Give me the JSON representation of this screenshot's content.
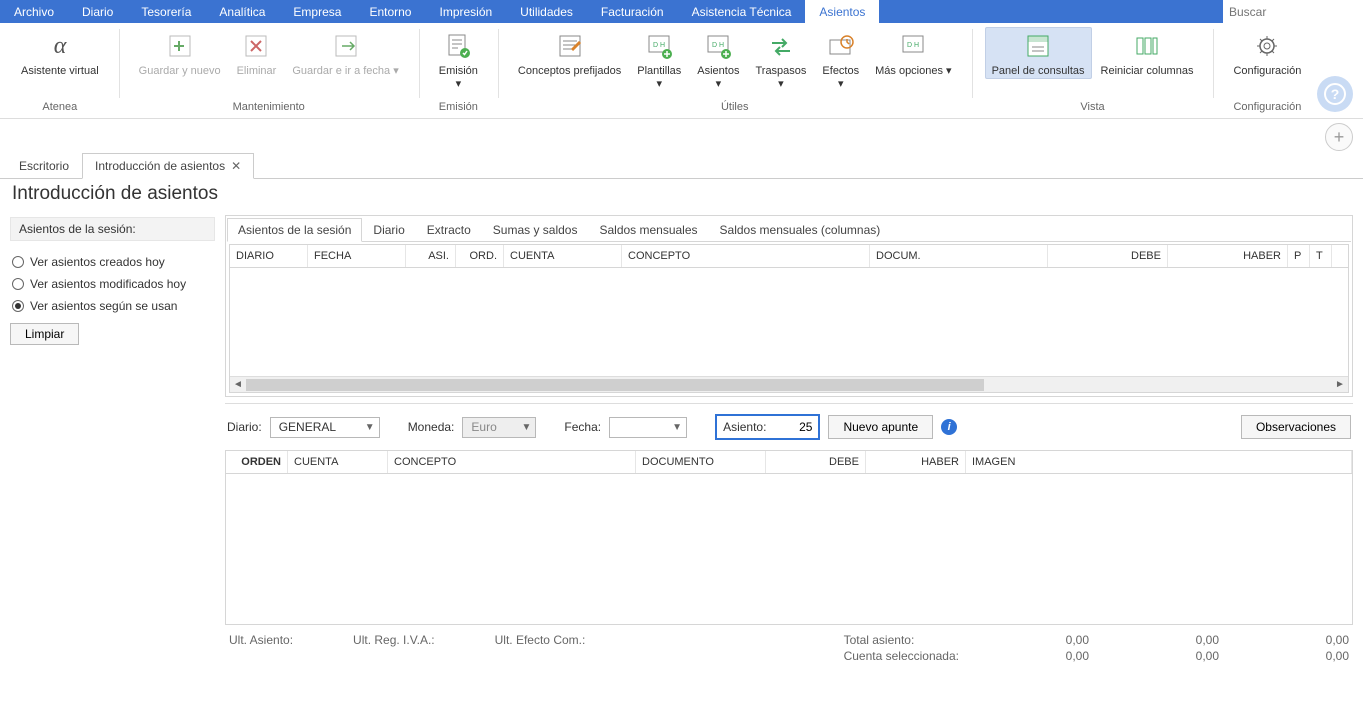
{
  "menus": [
    "Archivo",
    "Diario",
    "Tesorería",
    "Analítica",
    "Empresa",
    "Entorno",
    "Impresión",
    "Utilidades",
    "Facturación",
    "Asistencia Técnica",
    "Asientos"
  ],
  "active_menu_index": 10,
  "search_placeholder": "Buscar",
  "ribbon": {
    "groups": {
      "atenea": {
        "label": "Atenea",
        "asistente": "Asistente virtual"
      },
      "mantenimiento": {
        "label": "Mantenimiento",
        "guardar_nuevo": "Guardar y nuevo",
        "eliminar": "Eliminar",
        "guardar_ir": "Guardar e ir a fecha"
      },
      "emision": {
        "label": "Emisión",
        "emision": "Emisión"
      },
      "utiles": {
        "label": "Útiles",
        "conceptos": "Conceptos prefijados",
        "plantillas": "Plantillas",
        "asientos": "Asientos",
        "traspasos": "Traspasos",
        "efectos": "Efectos",
        "mas": "Más opciones"
      },
      "vista": {
        "label": "Vista",
        "panel": "Panel de consultas",
        "reiniciar": "Reiniciar columnas"
      },
      "config": {
        "label": "Configuración",
        "config": "Configuración"
      }
    }
  },
  "doc_tabs": {
    "escritorio": "Escritorio",
    "intro": "Introducción de asientos"
  },
  "page_title": "Introducción de asientos",
  "sidebar": {
    "section": "Asientos de la sesión:",
    "r1": "Ver asientos creados hoy",
    "r2": "Ver asientos modificados hoy",
    "r3": "Ver asientos según se usan",
    "limpiar": "Limpiar"
  },
  "inner_tabs": [
    "Asientos de la sesión",
    "Diario",
    "Extracto",
    "Sumas y saldos",
    "Saldos mensuales",
    "Saldos mensuales (columnas)"
  ],
  "grid1_cols": [
    "DIARIO",
    "FECHA",
    "ASI.",
    "ORD.",
    "CUENTA",
    "CONCEPTO",
    "DOCUM.",
    "DEBE",
    "HABER",
    "P",
    "T"
  ],
  "form": {
    "diario_label": "Diario:",
    "diario_value": "GENERAL",
    "moneda_label": "Moneda:",
    "moneda_value": "Euro",
    "fecha_label": "Fecha:",
    "fecha_value": "",
    "asiento_label": "Asiento:",
    "asiento_value": "25",
    "nuevo": "Nuevo apunte",
    "observ": "Observaciones"
  },
  "grid2_cols": [
    "ORDEN",
    "CUENTA",
    "CONCEPTO",
    "DOCUMENTO",
    "DEBE",
    "HABER",
    "IMAGEN"
  ],
  "footer": {
    "ult_asiento": "Ult. Asiento:",
    "ult_reg": "Ult. Reg. I.V.A.:",
    "ult_efecto": "Ult. Efecto Com.:",
    "total": "Total asiento:",
    "cuenta": "Cuenta seleccionada:",
    "v": "0,00"
  }
}
